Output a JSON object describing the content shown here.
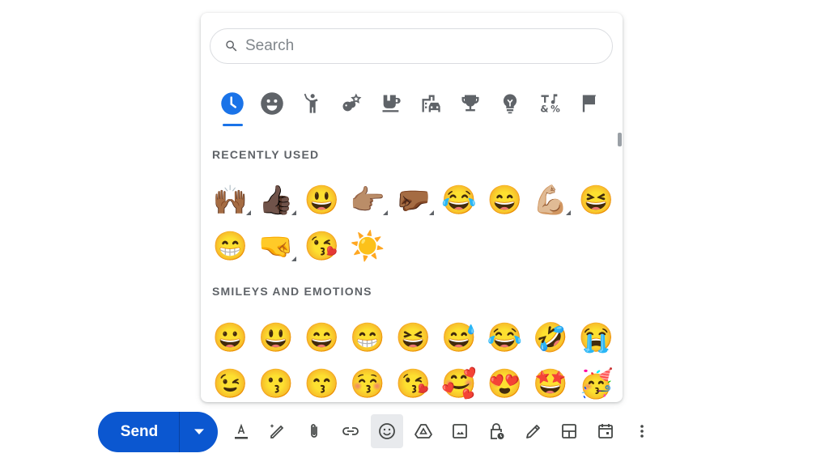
{
  "search": {
    "placeholder": "Search",
    "value": ""
  },
  "categories": [
    {
      "name": "recent",
      "icon": "clock-icon",
      "active": true
    },
    {
      "name": "smileys",
      "icon": "smiley-icon"
    },
    {
      "name": "people",
      "icon": "person-icon"
    },
    {
      "name": "nature",
      "icon": "animal-icon"
    },
    {
      "name": "food",
      "icon": "cup-icon"
    },
    {
      "name": "travel",
      "icon": "building-car-icon"
    },
    {
      "name": "activities",
      "icon": "trophy-icon"
    },
    {
      "name": "objects",
      "icon": "lightbulb-icon"
    },
    {
      "name": "symbols",
      "icon": "symbols-icon"
    },
    {
      "name": "flags",
      "icon": "flag-icon"
    }
  ],
  "sections": {
    "recent": {
      "label": "RECENTLY USED",
      "emojis": [
        {
          "char": "🙌🏾",
          "variant": true
        },
        {
          "char": "👍🏿",
          "variant": true
        },
        {
          "char": "😃"
        },
        {
          "char": "👉🏽",
          "variant": true
        },
        {
          "char": "🤛🏾",
          "variant": true
        },
        {
          "char": "😂"
        },
        {
          "char": "😄"
        },
        {
          "char": "💪🏼",
          "variant": true
        },
        {
          "char": "😆"
        },
        {
          "char": "😁"
        },
        {
          "char": "🤜",
          "variant": true
        },
        {
          "char": "😘"
        },
        {
          "char": "☀️"
        }
      ]
    },
    "smileys": {
      "label": "SMILEYS AND EMOTIONS",
      "emojis": [
        {
          "char": "😀"
        },
        {
          "char": "😃"
        },
        {
          "char": "😄"
        },
        {
          "char": "😁"
        },
        {
          "char": "😆"
        },
        {
          "char": "😅"
        },
        {
          "char": "😂"
        },
        {
          "char": "🤣"
        },
        {
          "char": "😭"
        },
        {
          "char": "😉"
        },
        {
          "char": "😗"
        },
        {
          "char": "😙"
        },
        {
          "char": "😚"
        },
        {
          "char": "😘"
        },
        {
          "char": "🥰"
        },
        {
          "char": "😍"
        },
        {
          "char": "🤩"
        },
        {
          "char": "🥳"
        }
      ]
    }
  },
  "compose": {
    "send_label": "Send",
    "toolbar": [
      {
        "name": "formatting-options",
        "icon": "text-format-icon"
      },
      {
        "name": "help-me-write",
        "icon": "magic-pen-icon"
      },
      {
        "name": "attach-files",
        "icon": "paperclip-icon"
      },
      {
        "name": "insert-link",
        "icon": "link-icon"
      },
      {
        "name": "insert-emoji",
        "icon": "emoji-icon",
        "active": true
      },
      {
        "name": "insert-drive",
        "icon": "drive-icon"
      },
      {
        "name": "insert-photo",
        "icon": "image-icon"
      },
      {
        "name": "confidential-mode",
        "icon": "lock-clock-icon"
      },
      {
        "name": "insert-signature",
        "icon": "pen-icon"
      },
      {
        "name": "templates",
        "icon": "layout-icon"
      },
      {
        "name": "set-up-time",
        "icon": "calendar-icon"
      },
      {
        "name": "more-options",
        "icon": "more-vert-icon"
      }
    ]
  },
  "colors": {
    "accent": "#1a73e8",
    "send": "#0b57d0",
    "icon": "#5f6368"
  }
}
